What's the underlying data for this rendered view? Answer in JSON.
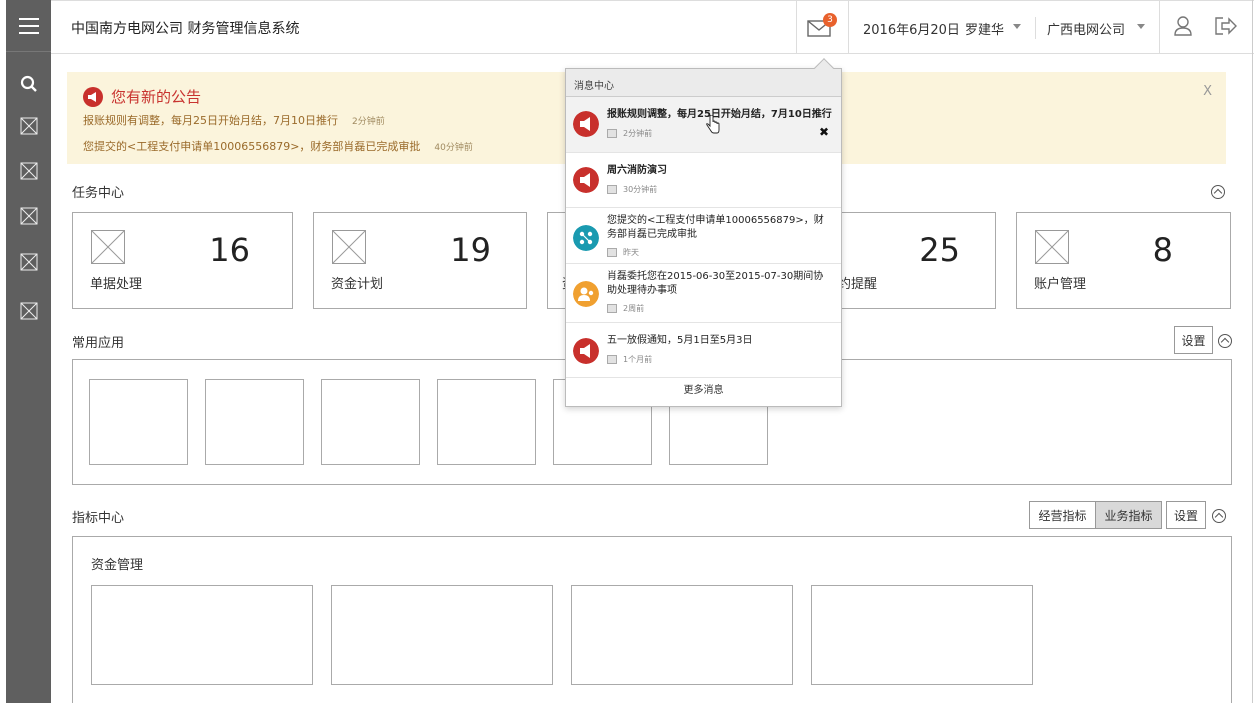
{
  "app": {
    "title": "中国南方电网公司 财务管理信息系统"
  },
  "header": {
    "mail_badge": "3",
    "date": "2016年6月20日",
    "user": "罗建华",
    "company": "广西电网公司",
    "icons": [
      "menu-icon",
      "mail-icon",
      "user-icon",
      "logout-icon"
    ]
  },
  "sidebar": {
    "icons": [
      "search-icon",
      "placeholder-icon",
      "placeholder-icon",
      "placeholder-icon",
      "placeholder-icon",
      "placeholder-icon"
    ]
  },
  "notice": {
    "title": "您有新的公告",
    "items": [
      {
        "text": "报账规则有调整，每月25日开始月结，7月10日推行",
        "time": "2分钟前"
      },
      {
        "text": "您提交的<工程支付申请单10006556879>，财务部肖磊已完成审批",
        "time": "40分钟前"
      }
    ],
    "close": "X"
  },
  "task_center": {
    "title": "任务中心",
    "cards": [
      {
        "label": "单据处理",
        "count": "16"
      },
      {
        "label": "资金计划",
        "count": "19"
      },
      {
        "label": "资",
        "count": ""
      },
      {
        "label": "约提醒",
        "count": "25"
      },
      {
        "label": "账户管理",
        "count": "8"
      }
    ]
  },
  "common_apps": {
    "title": "常用应用",
    "settings": "设置"
  },
  "index_center": {
    "title": "指标中心",
    "tabs": [
      "经营指标",
      "业务指标"
    ],
    "active_tab": "业务指标",
    "settings": "设置",
    "panel_title": "资金管理"
  },
  "message_center": {
    "title": "消息中心",
    "more": "更多消息",
    "messages": [
      {
        "text": "报账规则调整，每月25日开始月结，7月10日推行",
        "time": "2分钟前",
        "icon": "megaphone-icon",
        "color": "#c8302c"
      },
      {
        "text": "周六消防演习",
        "time": "30分钟前",
        "icon": "megaphone-icon",
        "color": "#c8302c"
      },
      {
        "text": "您提交的<工程支付申请单10006556879>，财务部肖磊已完成审批",
        "time": "昨天",
        "icon": "workflow-icon",
        "color": "#1a9ab0"
      },
      {
        "text": "肖磊委托您在2015-06-30至2015-07-30期间协助处理待办事项",
        "time": "2周前",
        "icon": "delegate-icon",
        "color": "#f0a030"
      },
      {
        "text": "五一放假通知，5月1日至5月3日",
        "time": "1个月前",
        "icon": "megaphone-icon",
        "color": "#c8302c"
      }
    ]
  }
}
